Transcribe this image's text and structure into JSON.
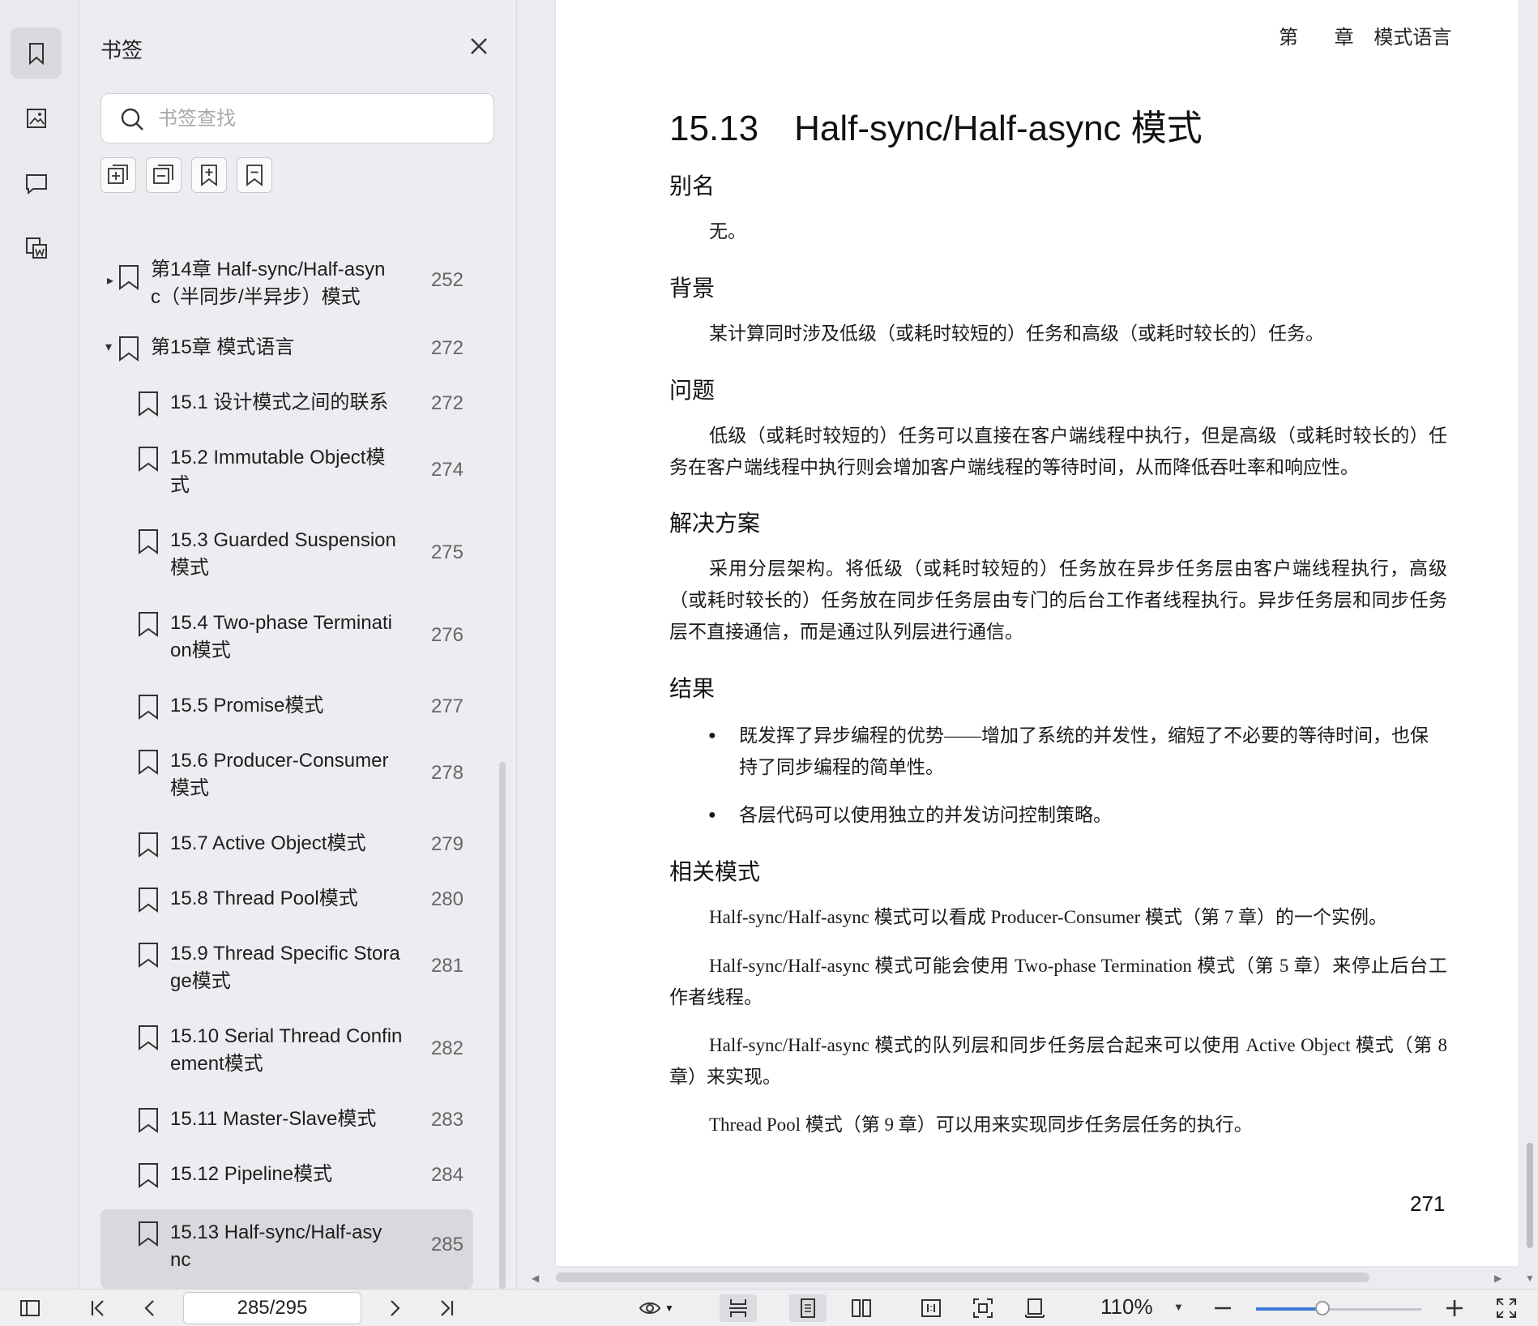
{
  "panel": {
    "title": "书签",
    "search_placeholder": "书签查找"
  },
  "bookmarks": [
    {
      "label": "第14章 Half-sync/Half-asyn",
      "label2": "c（半同步/半异步）模式",
      "page": "252",
      "arrow": "▸"
    },
    {
      "label": "第15章 模式语言",
      "label2": "",
      "page": "272",
      "arrow": "▾"
    },
    {
      "label": "15.1 设计模式之间的联系",
      "label2": "",
      "page": "272"
    },
    {
      "label": "15.2 Immutable Object模",
      "label2": "式",
      "page": "274"
    },
    {
      "label": "15.3 Guarded Suspension",
      "label2": "模式",
      "page": "275"
    },
    {
      "label": "15.4 Two-phase Terminati",
      "label2": "on模式",
      "page": "276"
    },
    {
      "label": "15.5 Promise模式",
      "label2": "",
      "page": "277"
    },
    {
      "label": "15.6 Producer-Consumer",
      "label2": "模式",
      "page": "278"
    },
    {
      "label": "15.7 Active Object模式",
      "label2": "",
      "page": "279"
    },
    {
      "label": "15.8 Thread Pool模式",
      "label2": "",
      "page": "280"
    },
    {
      "label": "15.9 Thread Specific Stora",
      "label2": "ge模式",
      "page": "281"
    },
    {
      "label": "15.10 Serial Thread Confin",
      "label2": "ement模式",
      "page": "282"
    },
    {
      "label": "15.11 Master-Slave模式",
      "label2": "",
      "page": "283"
    },
    {
      "label": "15.12 Pipeline模式",
      "label2": "",
      "page": "284"
    },
    {
      "label": "15.13 Half-sync/Half-asy",
      "label2": "nc",
      "page": "285",
      "selected": true
    }
  ],
  "document": {
    "running_head_1": "第",
    "running_head_2": "章",
    "running_head_3": "模式语言",
    "title_num": "15.13",
    "title_text": "Half-sync/Half-async 模式",
    "sec_alias": "别名",
    "alias_text": "无。",
    "sec_background": "背景",
    "background_text": "某计算同时涉及低级（或耗时较短的）任务和高级（或耗时较长的）任务。",
    "sec_problem": "问题",
    "problem_text": "低级（或耗时较短的）任务可以直接在客户端线程中执行，但是高级（或耗时较长的）任务在客户端线程中执行则会增加客户端线程的等待时间，从而降低吞吐率和响应性。",
    "sec_solution": "解决方案",
    "solution_text": "采用分层架构。将低级（或耗时较短的）任务放在异步任务层由客户端线程执行，高级（或耗时较长的）任务放在同步任务层由专门的后台工作者线程执行。异步任务层和同步任务层不直接通信，而是通过队列层进行通信。",
    "sec_result": "结果",
    "result_1": "既发挥了异步编程的优势——增加了系统的并发性，缩短了不必要的等待时间，也保持了同步编程的简单性。",
    "result_2": "各层代码可以使用独立的并发访问控制策略。",
    "sec_related": "相关模式",
    "related_1": "Half-sync/Half-async 模式可以看成 Producer-Consumer 模式（第 7 章）的一个实例。",
    "related_2": "Half-sync/Half-async 模式可能会使用 Two-phase Termination 模式（第 5 章）来停止后台工作者线程。",
    "related_3": "Half-sync/Half-async 模式的队列层和同步任务层合起来可以使用 Active Object 模式（第 8 章）来实现。",
    "related_4": "Thread Pool 模式（第 9 章）可以用来实现同步任务层任务的执行。",
    "page_number": "271"
  },
  "toolbar": {
    "page_indicator": "285/295",
    "zoom": "110%",
    "zoom_fraction": 0.4
  }
}
